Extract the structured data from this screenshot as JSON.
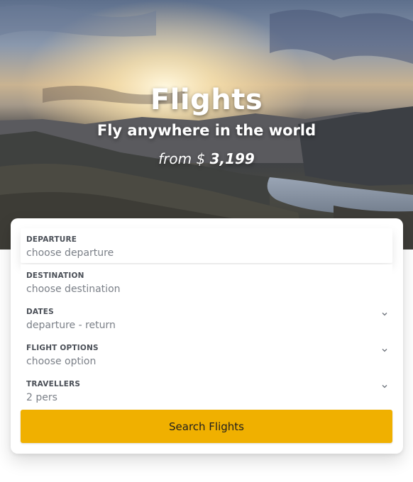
{
  "hero": {
    "title": "Flights",
    "subtitle": "Fly anywhere in the world",
    "price_prefix": "from $",
    "price_value": "3,199"
  },
  "form": {
    "fields": [
      {
        "label": "DEPARTURE",
        "placeholder": "choose departure",
        "icon": null
      },
      {
        "label": "DESTINATION",
        "placeholder": "choose destination",
        "icon": null
      },
      {
        "label": "DATES",
        "placeholder": "departure - return",
        "icon": "chevron-down-icon"
      },
      {
        "label": "FLIGHT OPTIONS",
        "placeholder": "choose option",
        "icon": "chevron-down-icon"
      },
      {
        "label": "TRAVELLERS",
        "placeholder": "2 pers",
        "icon": "chevron-down-icon"
      }
    ],
    "submit_label": "Search Flights"
  },
  "colors": {
    "accent": "#f0b000",
    "label": "#4a4f57",
    "value": "#7b8088"
  }
}
